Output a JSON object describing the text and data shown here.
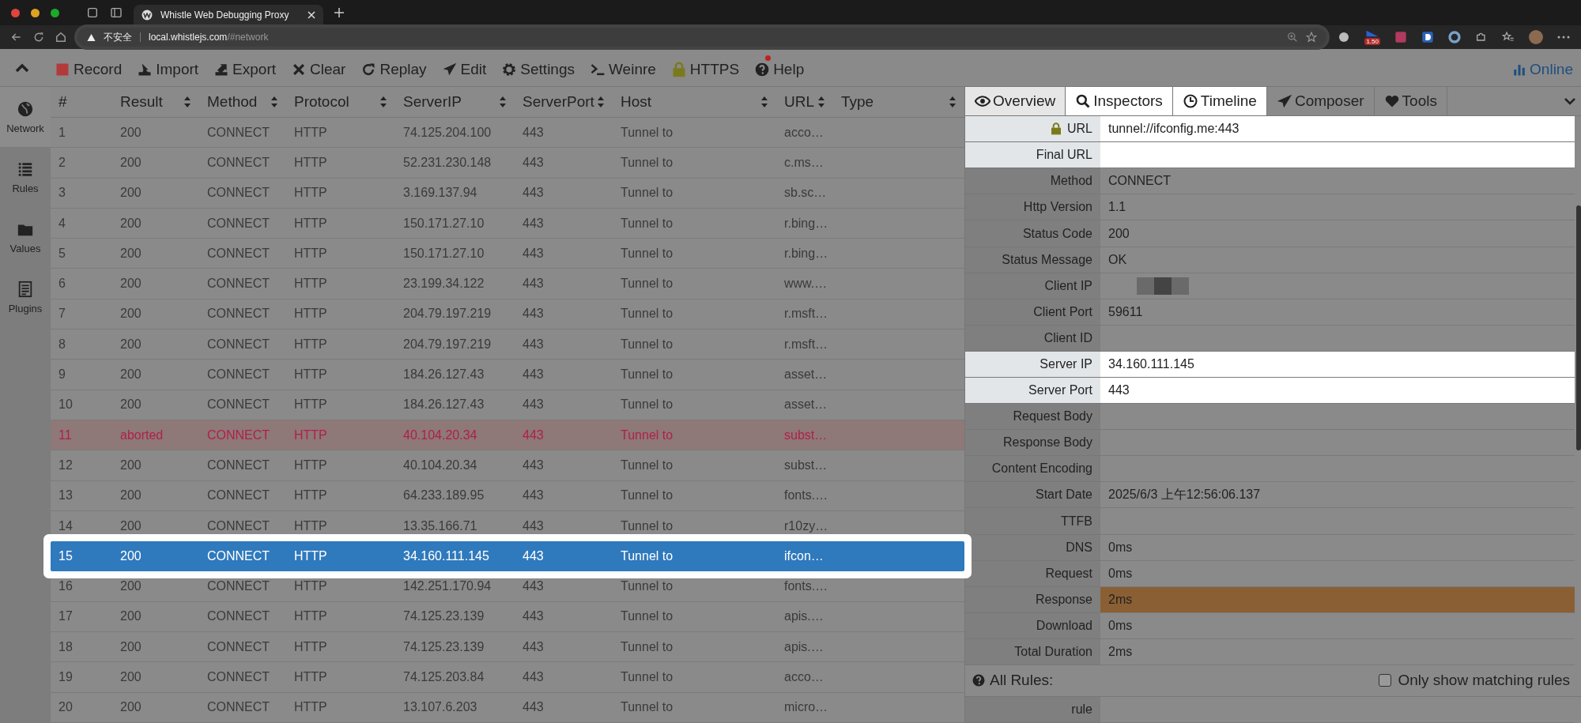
{
  "browser": {
    "tab_title": "Whistle Web Debugging Proxy",
    "security_label": "不安全",
    "url_host": "local.whistlejs.com",
    "url_path": "/#network",
    "extension_badge": "1.50",
    "address_highlighted": true
  },
  "toolbar": {
    "items": [
      {
        "label": "Record"
      },
      {
        "label": "Import"
      },
      {
        "label": "Export"
      },
      {
        "label": "Clear"
      },
      {
        "label": "Replay"
      },
      {
        "label": "Edit"
      },
      {
        "label": "Settings"
      },
      {
        "label": "Weinre"
      },
      {
        "label": "HTTPS"
      },
      {
        "label": "Help",
        "notify": true
      }
    ],
    "status": "Online"
  },
  "sidebar": {
    "items": [
      {
        "label": "Network",
        "selected": true
      },
      {
        "label": "Rules",
        "selected": false
      },
      {
        "label": "Values",
        "selected": false
      },
      {
        "label": "Plugins",
        "selected": false
      }
    ]
  },
  "table": {
    "columns": [
      {
        "label": "#",
        "sortable": false
      },
      {
        "label": "Result",
        "sortable": true
      },
      {
        "label": "Method",
        "sortable": true
      },
      {
        "label": "Protocol",
        "sortable": true
      },
      {
        "label": "ServerIP",
        "sortable": true
      },
      {
        "label": "ServerPort",
        "sortable": true
      },
      {
        "label": "Host",
        "sortable": true
      },
      {
        "label": "URL",
        "sortable": true
      },
      {
        "label": "Type",
        "sortable": true
      }
    ],
    "rows": [
      {
        "cells": [
          "1",
          "200",
          "CONNECT",
          "HTTP",
          "74.125.204.100",
          "443",
          "Tunnel to",
          "acco…"
        ],
        "kind": "normal",
        "selected": false
      },
      {
        "cells": [
          "2",
          "200",
          "CONNECT",
          "HTTP",
          "52.231.230.148",
          "443",
          "Tunnel to",
          "c.ms…"
        ],
        "kind": "normal",
        "selected": false
      },
      {
        "cells": [
          "3",
          "200",
          "CONNECT",
          "HTTP",
          "3.169.137.94",
          "443",
          "Tunnel to",
          "sb.sc…"
        ],
        "kind": "normal",
        "selected": false
      },
      {
        "cells": [
          "4",
          "200",
          "CONNECT",
          "HTTP",
          "150.171.27.10",
          "443",
          "Tunnel to",
          "r.bing…"
        ],
        "kind": "normal",
        "selected": false
      },
      {
        "cells": [
          "5",
          "200",
          "CONNECT",
          "HTTP",
          "150.171.27.10",
          "443",
          "Tunnel to",
          "r.bing…"
        ],
        "kind": "normal",
        "selected": false
      },
      {
        "cells": [
          "6",
          "200",
          "CONNECT",
          "HTTP",
          "23.199.34.122",
          "443",
          "Tunnel to",
          "www.…"
        ],
        "kind": "normal",
        "selected": false
      },
      {
        "cells": [
          "7",
          "200",
          "CONNECT",
          "HTTP",
          "204.79.197.219",
          "443",
          "Tunnel to",
          "r.msft…"
        ],
        "kind": "normal",
        "selected": false
      },
      {
        "cells": [
          "8",
          "200",
          "CONNECT",
          "HTTP",
          "204.79.197.219",
          "443",
          "Tunnel to",
          "r.msft…"
        ],
        "kind": "normal",
        "selected": false
      },
      {
        "cells": [
          "9",
          "200",
          "CONNECT",
          "HTTP",
          "184.26.127.43",
          "443",
          "Tunnel to",
          "asset…"
        ],
        "kind": "normal",
        "selected": false
      },
      {
        "cells": [
          "10",
          "200",
          "CONNECT",
          "HTTP",
          "184.26.127.43",
          "443",
          "Tunnel to",
          "asset…"
        ],
        "kind": "normal",
        "selected": false
      },
      {
        "cells": [
          "11",
          "aborted",
          "CONNECT",
          "HTTP",
          "40.104.20.34",
          "443",
          "Tunnel to",
          "subst…"
        ],
        "kind": "error",
        "selected": false
      },
      {
        "cells": [
          "12",
          "200",
          "CONNECT",
          "HTTP",
          "40.104.20.34",
          "443",
          "Tunnel to",
          "subst…"
        ],
        "kind": "normal",
        "selected": false
      },
      {
        "cells": [
          "13",
          "200",
          "CONNECT",
          "HTTP",
          "64.233.189.95",
          "443",
          "Tunnel to",
          "fonts.…"
        ],
        "kind": "normal",
        "selected": false
      },
      {
        "cells": [
          "14",
          "200",
          "CONNECT",
          "HTTP",
          "13.35.166.71",
          "443",
          "Tunnel to",
          "r10zy…"
        ],
        "kind": "normal",
        "selected": false
      },
      {
        "cells": [
          "15",
          "200",
          "CONNECT",
          "HTTP",
          "34.160.111.145",
          "443",
          "Tunnel to",
          "ifcon…"
        ],
        "kind": "normal",
        "selected": true
      },
      {
        "cells": [
          "16",
          "200",
          "CONNECT",
          "HTTP",
          "142.251.170.94",
          "443",
          "Tunnel to",
          "fonts.…"
        ],
        "kind": "normal",
        "selected": false
      },
      {
        "cells": [
          "17",
          "200",
          "CONNECT",
          "HTTP",
          "74.125.23.139",
          "443",
          "Tunnel to",
          "apis.…"
        ],
        "kind": "normal",
        "selected": false
      },
      {
        "cells": [
          "18",
          "200",
          "CONNECT",
          "HTTP",
          "74.125.23.139",
          "443",
          "Tunnel to",
          "apis.…"
        ],
        "kind": "normal",
        "selected": false
      },
      {
        "cells": [
          "19",
          "200",
          "CONNECT",
          "HTTP",
          "74.125.203.84",
          "443",
          "Tunnel to",
          "acco…"
        ],
        "kind": "normal",
        "selected": false
      },
      {
        "cells": [
          "20",
          "200",
          "CONNECT",
          "HTTP",
          "13.107.6.203",
          "443",
          "Tunnel to",
          "micro…"
        ],
        "kind": "normal",
        "selected": false
      }
    ]
  },
  "detail": {
    "tabs": [
      {
        "label": "Overview",
        "selected": true,
        "highlighted": true
      },
      {
        "label": "Inspectors",
        "selected": false,
        "highlighted": true
      },
      {
        "label": "Timeline",
        "selected": false,
        "highlighted": true
      },
      {
        "label": "Composer",
        "selected": false,
        "highlighted": false
      },
      {
        "label": "Tools",
        "selected": false,
        "highlighted": false
      }
    ],
    "properties": [
      {
        "label": "URL",
        "value": "tunnel://ifconfig.me:443",
        "secure": true,
        "highlighted": true
      },
      {
        "label": "Final URL",
        "highlighted": true
      },
      {
        "label": "Method",
        "value": "CONNECT",
        "highlighted": false
      },
      {
        "label": "Http Version",
        "value": "1.1",
        "highlighted": false
      },
      {
        "label": "Status Code",
        "value": "200",
        "highlighted": false
      },
      {
        "label": "Status Message",
        "value": "OK",
        "highlighted": false
      },
      {
        "label": "Client IP",
        "blurred": true,
        "highlighted": false
      },
      {
        "label": "Client Port",
        "value": "59611",
        "highlighted": false
      },
      {
        "label": "Client ID",
        "highlighted": false
      },
      {
        "label": "Server IP",
        "value": "34.160.111.145",
        "highlighted": true
      },
      {
        "label": "Server Port",
        "value": "443",
        "highlighted": true
      },
      {
        "label": "Request Body",
        "highlighted": false
      },
      {
        "label": "Response Body",
        "highlighted": false
      },
      {
        "label": "Content Encoding",
        "highlighted": false
      },
      {
        "label": "Start Date",
        "value": "2025/6/3 上午12:56:06.137",
        "highlighted": false
      },
      {
        "label": "TTFB",
        "highlighted": false
      },
      {
        "label": "DNS",
        "value": "0ms",
        "highlighted": false
      },
      {
        "label": "Request",
        "value": "0ms",
        "highlighted": false
      },
      {
        "label": "Response",
        "value": "2ms",
        "color": "#8b5f34",
        "highlighted": false
      },
      {
        "label": "Download",
        "value": "0ms",
        "highlighted": false
      },
      {
        "label": "Total Duration",
        "value": "2ms",
        "highlighted": false
      }
    ],
    "rules": {
      "title": "All Rules:",
      "filter_label": "Only show matching rules",
      "filter_checked": false,
      "rows": [
        {
          "label": "rule"
        }
      ]
    }
  }
}
